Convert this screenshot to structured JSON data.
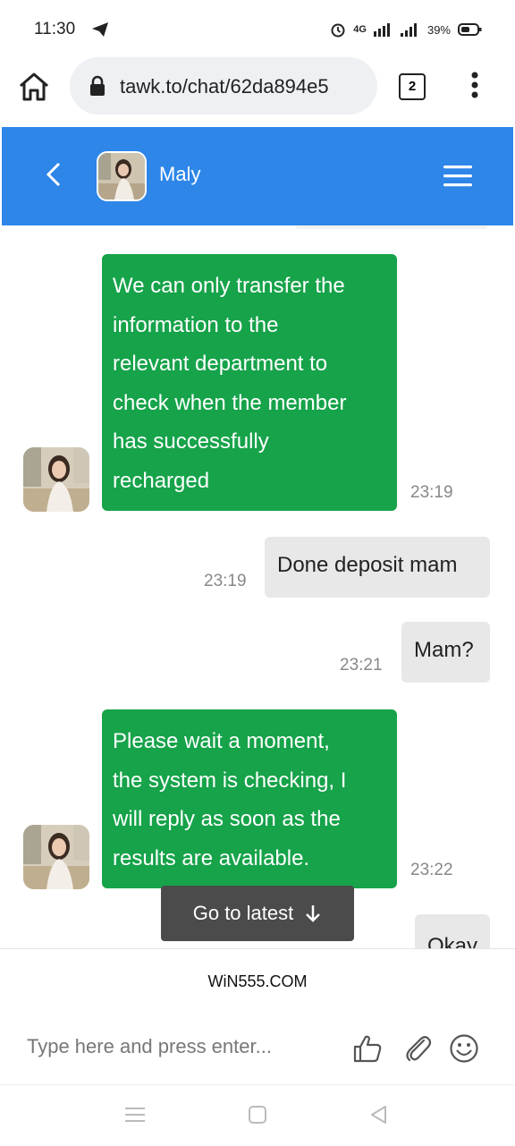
{
  "status": {
    "time": "11:30",
    "network": "4G",
    "battery": "39%"
  },
  "browser": {
    "url": "tawk.to/chat/62da894e5",
    "tab_count": "2"
  },
  "chat": {
    "agent_name": "Maly"
  },
  "messages": [
    {
      "from": "agent",
      "lines": [
        "We can only transfer the",
        "information to the",
        "relevant department to",
        "check when the member",
        "has successfully",
        "recharged"
      ],
      "time": "23:19"
    },
    {
      "from": "visitor",
      "text": "Done deposit mam",
      "time": "23:19"
    },
    {
      "from": "visitor",
      "text": "Mam?",
      "time": "23:21"
    },
    {
      "from": "agent",
      "lines": [
        "Please wait a moment,",
        "the system is checking, I",
        "will reply as soon as the",
        "results are available."
      ],
      "time": "23:22"
    },
    {
      "from": "visitor",
      "text": "Okay"
    }
  ],
  "go_to_latest": "Go to latest",
  "footer": {
    "brand": "WiN555.COM",
    "input_placeholder": "Type here and press enter..."
  },
  "colors": {
    "header_blue": "#2d86e8",
    "agent_bubble_green": "#16a34a",
    "visitor_bubble_gray": "#e8e8e8"
  }
}
